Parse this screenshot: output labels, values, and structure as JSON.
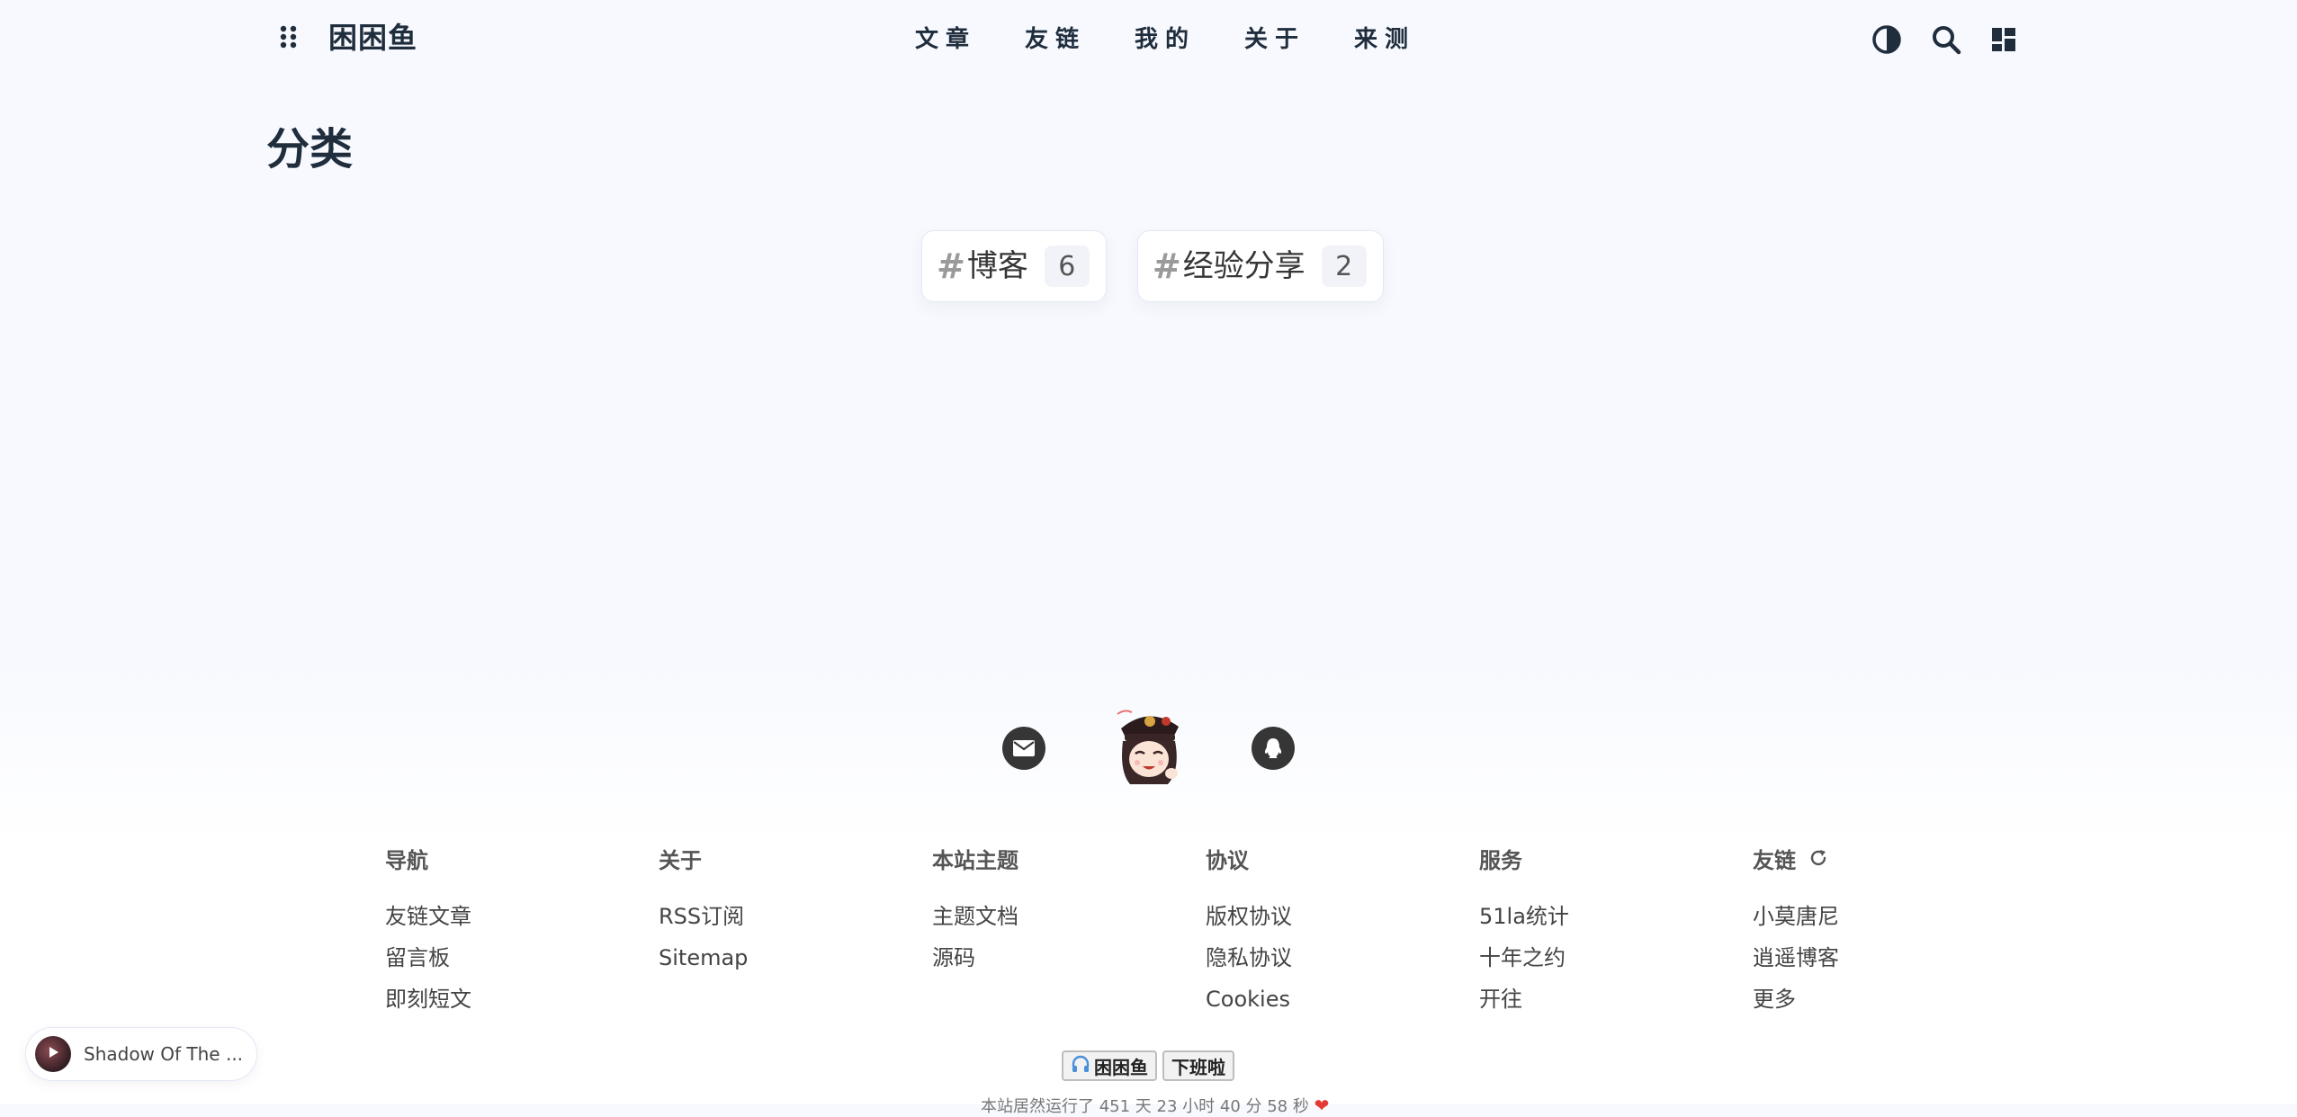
{
  "header": {
    "site_title": "困困鱼",
    "nav": [
      "文章",
      "友链",
      "我的",
      "关于",
      "来测"
    ],
    "icons": [
      "theme-toggle-icon",
      "search-icon",
      "dashboard-icon"
    ]
  },
  "page": {
    "title": "分类",
    "categories": [
      {
        "hash": "#",
        "name": "博客",
        "count": "6"
      },
      {
        "hash": "#",
        "name": "经验分享",
        "count": "2"
      }
    ]
  },
  "footer": {
    "social": [
      "mail-icon",
      "avatar",
      "qq-icon"
    ],
    "columns": [
      {
        "title": "导航",
        "links": [
          "友链文章",
          "留言板",
          "即刻短文"
        ]
      },
      {
        "title": "关于",
        "links": [
          "RSS订阅",
          "Sitemap"
        ]
      },
      {
        "title": "本站主题",
        "links": [
          "主题文档",
          "源码"
        ]
      },
      {
        "title": "协议",
        "links": [
          "版权协议",
          "隐私协议",
          "Cookies"
        ]
      },
      {
        "title": "服务",
        "links": [
          "51la统计",
          "十年之约",
          "开往"
        ]
      },
      {
        "title": "友链",
        "links": [
          "小莫唐尼",
          "逍遥博客",
          "更多"
        ]
      }
    ],
    "badges": [
      "困困鱼",
      "下班啦"
    ],
    "runtime": "本站居然运行了 451 天 23 小时 40 分 58 秒"
  },
  "player": {
    "title": "Shadow Of The ..."
  },
  "colors": {
    "background": "#f7f9fe",
    "text_dark": "#1f2d3d",
    "heart": "#e53935"
  }
}
